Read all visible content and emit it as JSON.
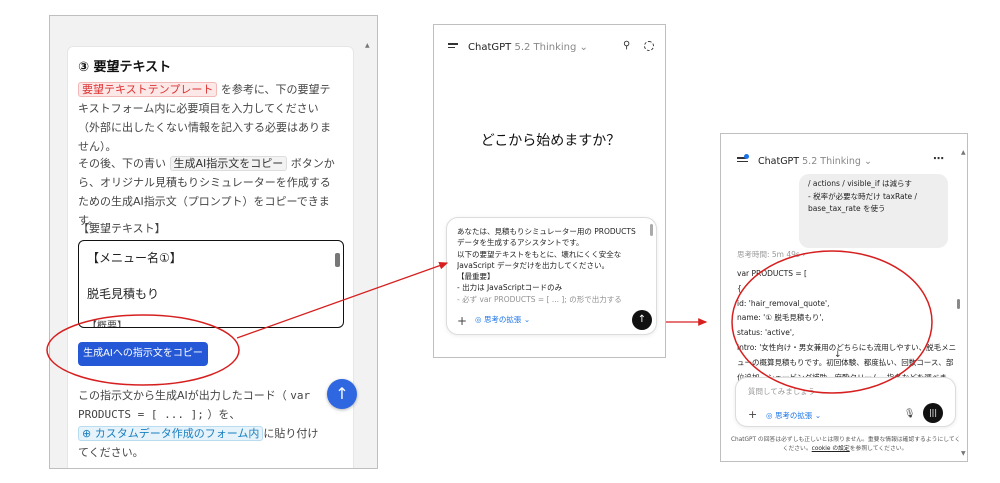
{
  "panel1": {
    "title": "③ 要望テキスト",
    "para1": {
      "chip": "要望テキストテンプレート",
      "text": " を参考に、下の要望テキストフォーム内に必要項目を入力してください（外部に出したくない情報を記入する必要はありません）。"
    },
    "para2": {
      "pre": "その後、下の青い ",
      "chip": "生成AI指示文をコピー",
      "post": " ボタンから、オリジナル見積もりシミュレーターを作成するための生成AI指示文（プロンプト）をコピーできます。"
    },
    "label": "【要望テキスト】",
    "textarea": {
      "line1": "【メニュー名①】",
      "line2": "脱毛見積もり",
      "line3": "【概要】"
    },
    "copy_button": "生成AIへの指示文をコピー",
    "para3": {
      "pre": "この指示文から生成AIが出力したコード（ ",
      "code": "var PRODUCTS = [ ... ];",
      "mid": " ）を、",
      "chip": "カスタムデータ作成のフォーム内",
      "post": "に貼り付けてください。"
    },
    "up_button": "↑"
  },
  "panel2": {
    "app_name": "ChatGPT",
    "version": "5.2 Thinking ⌄",
    "greeting": "どこから始めますか？",
    "input_lines": [
      "あなたは、見積もりシミュレーター用の PRODUCTS データを生成するアシスタントです。",
      "以下の要望テキストをもとに、壊れにくく安全な JavaScript データだけを出力してください。",
      "【最重要】",
      "- 出力は JavaScriptコードのみ",
      "- 必ず var PRODUCTS = [ ... ]; の形で出力する"
    ],
    "think_label": "思考の拡張 ⌄"
  },
  "panel3": {
    "app_name": "ChatGPT",
    "version": "5.2 Thinking ⌄",
    "bubble_lines": [
      "/ actions / visible_if は減らす",
      "- 税率が必要な時だけ taxRate /",
      "base_tax_rate を使う"
    ],
    "think_time": "思考時間: 5m 49s ›",
    "code_lines": [
      "var PRODUCTS = [",
      "{",
      "id: 'hair_removal_quote',",
      "name: '① 脱毛見積もり',",
      "status: 'active',",
      "intro: '女性向け・男女兼用のどちらにも流用しやすい、脱毛メニューの概算見積もりです。初回体験、都度払い、回数コース、部位追加、シェービング補助、麻酔クリーム、指名などを選べま"
    ],
    "placeholder": "質問してみましょう",
    "think_label": "思考の拡張 ⌄",
    "disclaimer_line1": "ChatGPT の回答は必ずしも正しいとは限りません。重要な情報は確認するようにしてください。",
    "disclaimer_pre": "ください。",
    "disclaimer_link": "cookie の設定",
    "disclaimer_post": "を参照してください。"
  },
  "colors": {
    "annotation_red": "#d62020",
    "primary_blue": "#2458d6",
    "scroll_button_blue": "#2f67e0",
    "link_blue": "#1a73e8"
  }
}
